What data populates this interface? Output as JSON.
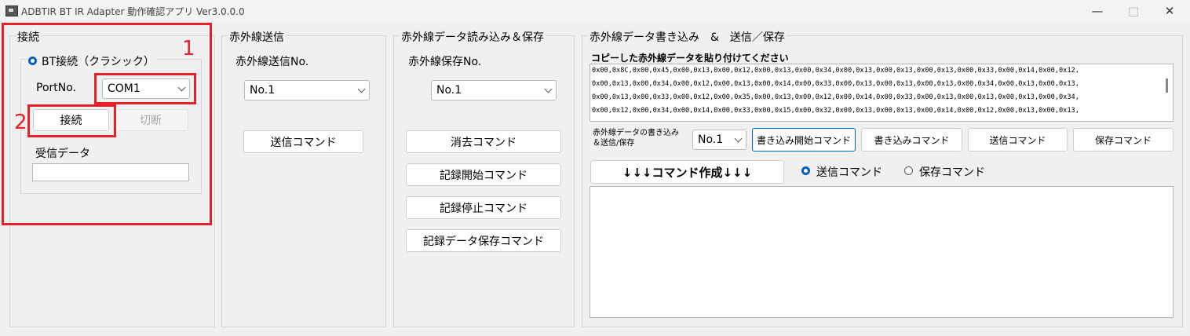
{
  "window": {
    "title": "ADBTIR BT IR Adapter 動作確認アプリ Ver3.0.0.0",
    "minimize_icon": "minimize-icon",
    "maximize_icon": "maximize-icon",
    "close_icon": "close-icon"
  },
  "connection": {
    "group_label": "接続",
    "bt_classic_label": "BT接続（クラシック）",
    "port_label": "PortNo.",
    "port_value": "COM1",
    "connect_label": "接続",
    "disconnect_label": "切断",
    "received_label": "受信データ",
    "received_value": ""
  },
  "annotations": {
    "mark1": "1",
    "mark2": "2",
    "color": "#e8202a"
  },
  "ir_send": {
    "group_label": "赤外線送信",
    "no_label": "赤外線送信No.",
    "no_value": "No.1",
    "send_cmd_label": "送信コマンド"
  },
  "ir_read": {
    "group_label": "赤外線データ読み込み＆保存",
    "no_label": "赤外線保存No.",
    "no_value": "No.1",
    "erase_label": "消去コマンド",
    "rec_start_label": "記録開始コマンド",
    "rec_stop_label": "記録停止コマンド",
    "rec_save_label": "記録データ保存コマンド"
  },
  "ir_write": {
    "group_label": "赤外線データ書き込み　&　送信／保存",
    "paste_label": "コピーした赤外線データを貼り付けてください",
    "hex_lines": [
      "0x00,0x8C,0x00,0x45,0x00,0x13,0x00,0x12,0x00,0x13,0x00,0x34,0x00,0x13,0x00,0x13,0x00,0x13,0x00,0x33,0x00,0x14,0x00,0x12,",
      "0x00,0x13,0x00,0x34,0x00,0x12,0x00,0x13,0x00,0x14,0x00,0x33,0x00,0x13,0x00,0x13,0x00,0x13,0x00,0x34,0x00,0x13,0x00,0x13,",
      "0x00,0x13,0x00,0x33,0x00,0x12,0x00,0x35,0x00,0x13,0x00,0x12,0x00,0x14,0x00,0x33,0x00,0x13,0x00,0x13,0x00,0x13,0x00,0x34,",
      "0x00,0x12,0x00,0x34,0x00,0x14,0x00,0x33,0x00,0x15,0x00,0x32,0x00,0x13,0x00,0x13,0x00,0x14,0x00,0x12,0x00,0x13,0x00,0x13,"
    ],
    "write_send_save_label_1": "赤外線データの書き込み",
    "write_send_save_label_2": "＆送信/保存",
    "no_value": "No.1",
    "write_start_label": "書き込み開始コマンド",
    "write_cmd_label": "書き込みコマンド",
    "send_cmd_label": "送信コマンド",
    "save_cmd_label": "保存コマンド",
    "make_cmd_label": "↓↓↓コマンド作成↓↓↓",
    "radio_send_label": "送信コマンド",
    "radio_save_label": "保存コマンド",
    "output_value": ""
  }
}
